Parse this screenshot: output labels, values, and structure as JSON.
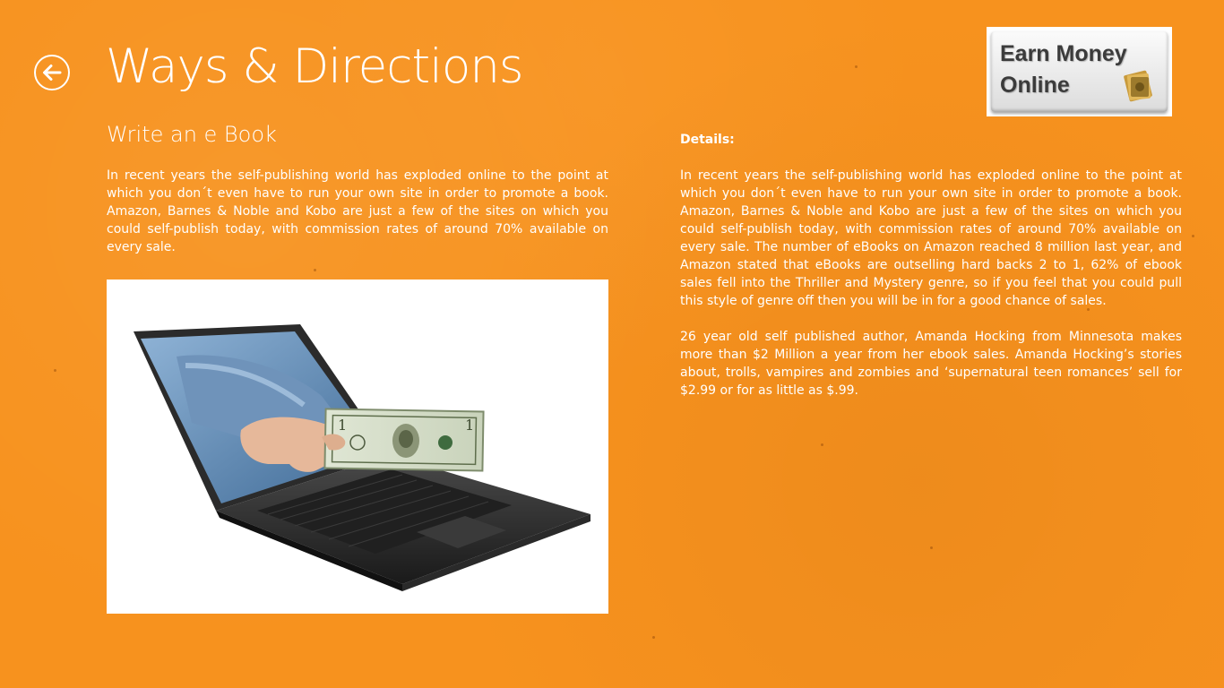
{
  "header": {
    "back_label": "Back",
    "title": "Ways & Directions"
  },
  "logo": {
    "line1": "Earn Money",
    "line2": "Online"
  },
  "article": {
    "subtitle": "Write an e Book",
    "summary": "In recent years the self-publishing world has exploded online to the point at which you don´t even have to run your own site in order to promote a book. Amazon, Barnes & Noble and Kobo are just a few of the sites on which you could self-publish today, with commission rates of around 70% available on every sale.",
    "image_icon": "laptop-with-dollar-bill-image"
  },
  "details": {
    "heading": "Details:",
    "paragraphs": [
      "In recent years the self-publishing world has exploded online to the point at which you don´t even have to run your own site in order to promote a book. Amazon, Barnes & Noble and Kobo are just a few of the sites on which you could self-publish today, with commission rates of around 70% available on every sale. The number of eBooks on Amazon reached 8 million last year, and Amazon stated that eBooks are outselling hard backs 2 to 1, 62% of ebook sales fell into the Thriller and Mystery genre, so if you feel that you could pull this style of genre off then you will be in for a good chance of sales.",
      "26 year old self published author, Amanda Hocking from Minnesota makes more than $2 Million a year from her ebook sales. Amanda Hocking’s stories about, trolls, vampires and zombies and  ‘supernatural teen romances’ sell for $2.99 or for as little as $.99."
    ]
  },
  "colors": {
    "background": "#f7921e",
    "text": "#ffffff"
  }
}
